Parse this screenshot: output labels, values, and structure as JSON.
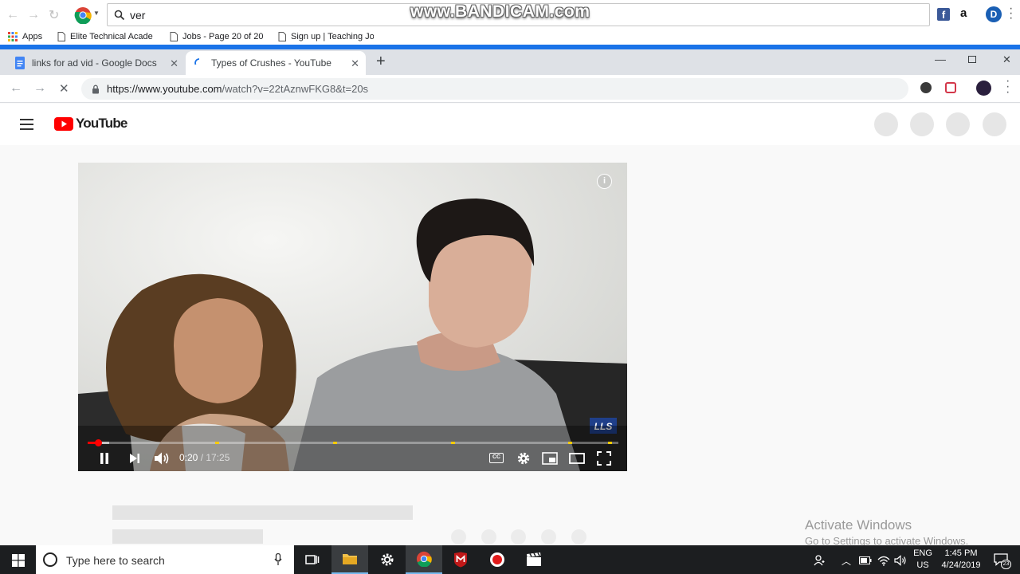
{
  "outer_browser": {
    "omnibox_value": "ver",
    "watermark": "www.BANDICAM.com",
    "bookmarks": [
      {
        "label": "Apps"
      },
      {
        "label": "Elite Technical Acade"
      },
      {
        "label": "Jobs - Page 20 of 20"
      },
      {
        "label": "Sign up | Teaching Jo"
      }
    ]
  },
  "browser": {
    "tabs": [
      {
        "label": "links for ad vid - Google Docs",
        "active": false
      },
      {
        "label": "Types of Crushes - YouTube",
        "active": true
      }
    ],
    "url_host": "https://www.youtube.com",
    "url_path": "/watch?v=22tAznwFKG8&t=20s"
  },
  "youtube": {
    "logo_text": "YouTube",
    "player": {
      "time_current": "0:20",
      "time_separator": " / ",
      "time_total": "17:25",
      "progress_fraction": 0.019,
      "buffered_fraction": 0.04,
      "chapter_markers": [
        0.243,
        0.465,
        0.687,
        0.909,
        0.983
      ],
      "channel_watermark": "LLS"
    }
  },
  "windows_notice": {
    "line1": "Activate Windows",
    "line2": "Go to Settings to activate Windows."
  },
  "taskbar": {
    "search_placeholder": "Type here to search",
    "language_top": "ENG",
    "language_bottom": "US",
    "time": "1:45 PM",
    "date": "4/24/2019",
    "notification_count": "23"
  },
  "colors": {
    "chrome_blue": "#1a73e8",
    "youtube_red": "#ff0000",
    "chapter_marker": "#ffcc00",
    "taskbar": "#1c1e20"
  }
}
